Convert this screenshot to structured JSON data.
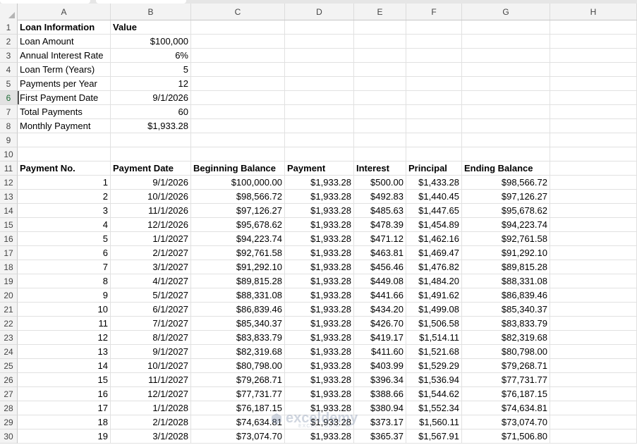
{
  "columns": [
    "A",
    "B",
    "C",
    "D",
    "E",
    "F",
    "G",
    "H"
  ],
  "watermark": {
    "title": "exceldemy",
    "subtitle": "EXCEL · DATA · BI"
  },
  "rows": [
    {
      "n": "1",
      "cells": [
        {
          "v": "Loan Information",
          "b": true
        },
        {
          "v": "Value",
          "b": true
        },
        {
          "v": ""
        },
        {
          "v": ""
        },
        {
          "v": ""
        },
        {
          "v": ""
        },
        {
          "v": ""
        },
        {
          "v": ""
        }
      ]
    },
    {
      "n": "2",
      "cells": [
        {
          "v": "Loan Amount"
        },
        {
          "v": "$100,000",
          "r": true
        },
        {
          "v": ""
        },
        {
          "v": ""
        },
        {
          "v": ""
        },
        {
          "v": ""
        },
        {
          "v": ""
        },
        {
          "v": ""
        }
      ]
    },
    {
      "n": "3",
      "cells": [
        {
          "v": "Annual Interest Rate"
        },
        {
          "v": "6%",
          "r": true
        },
        {
          "v": ""
        },
        {
          "v": ""
        },
        {
          "v": ""
        },
        {
          "v": ""
        },
        {
          "v": ""
        },
        {
          "v": ""
        }
      ]
    },
    {
      "n": "4",
      "cells": [
        {
          "v": "Loan Term (Years)"
        },
        {
          "v": "5",
          "r": true
        },
        {
          "v": ""
        },
        {
          "v": ""
        },
        {
          "v": ""
        },
        {
          "v": ""
        },
        {
          "v": ""
        },
        {
          "v": ""
        }
      ]
    },
    {
      "n": "5",
      "cells": [
        {
          "v": "Payments per Year"
        },
        {
          "v": "12",
          "r": true
        },
        {
          "v": ""
        },
        {
          "v": ""
        },
        {
          "v": ""
        },
        {
          "v": ""
        },
        {
          "v": ""
        },
        {
          "v": ""
        }
      ]
    },
    {
      "n": "6",
      "selected": true,
      "cells": [
        {
          "v": "First Payment Date",
          "active": true
        },
        {
          "v": "9/1/2026",
          "r": true
        },
        {
          "v": ""
        },
        {
          "v": ""
        },
        {
          "v": ""
        },
        {
          "v": ""
        },
        {
          "v": ""
        },
        {
          "v": ""
        }
      ]
    },
    {
      "n": "7",
      "cells": [
        {
          "v": "Total Payments"
        },
        {
          "v": "60",
          "r": true
        },
        {
          "v": ""
        },
        {
          "v": ""
        },
        {
          "v": ""
        },
        {
          "v": ""
        },
        {
          "v": ""
        },
        {
          "v": ""
        }
      ]
    },
    {
      "n": "8",
      "cells": [
        {
          "v": "Monthly Payment"
        },
        {
          "v": "$1,933.28",
          "r": true
        },
        {
          "v": ""
        },
        {
          "v": ""
        },
        {
          "v": ""
        },
        {
          "v": ""
        },
        {
          "v": ""
        },
        {
          "v": ""
        }
      ]
    },
    {
      "n": "9",
      "cells": [
        {
          "v": ""
        },
        {
          "v": ""
        },
        {
          "v": ""
        },
        {
          "v": ""
        },
        {
          "v": ""
        },
        {
          "v": ""
        },
        {
          "v": ""
        },
        {
          "v": ""
        }
      ]
    },
    {
      "n": "10",
      "cells": [
        {
          "v": ""
        },
        {
          "v": ""
        },
        {
          "v": ""
        },
        {
          "v": ""
        },
        {
          "v": ""
        },
        {
          "v": ""
        },
        {
          "v": ""
        },
        {
          "v": ""
        }
      ]
    },
    {
      "n": "11",
      "cells": [
        {
          "v": "Payment No.",
          "b": true
        },
        {
          "v": "Payment Date",
          "b": true
        },
        {
          "v": "Beginning Balance",
          "b": true
        },
        {
          "v": "Payment",
          "b": true
        },
        {
          "v": "Interest",
          "b": true
        },
        {
          "v": "Principal",
          "b": true
        },
        {
          "v": "Ending Balance",
          "b": true
        },
        {
          "v": ""
        }
      ]
    },
    {
      "n": "12",
      "cells": [
        {
          "v": "1",
          "r": true
        },
        {
          "v": "9/1/2026",
          "r": true
        },
        {
          "v": "$100,000.00",
          "r": true
        },
        {
          "v": "$1,933.28",
          "r": true
        },
        {
          "v": "$500.00",
          "r": true
        },
        {
          "v": "$1,433.28",
          "r": true
        },
        {
          "v": "$98,566.72",
          "r": true
        },
        {
          "v": ""
        }
      ]
    },
    {
      "n": "13",
      "cells": [
        {
          "v": "2",
          "r": true
        },
        {
          "v": "10/1/2026",
          "r": true
        },
        {
          "v": "$98,566.72",
          "r": true
        },
        {
          "v": "$1,933.28",
          "r": true
        },
        {
          "v": "$492.83",
          "r": true
        },
        {
          "v": "$1,440.45",
          "r": true
        },
        {
          "v": "$97,126.27",
          "r": true
        },
        {
          "v": ""
        }
      ]
    },
    {
      "n": "14",
      "cells": [
        {
          "v": "3",
          "r": true
        },
        {
          "v": "11/1/2026",
          "r": true
        },
        {
          "v": "$97,126.27",
          "r": true
        },
        {
          "v": "$1,933.28",
          "r": true
        },
        {
          "v": "$485.63",
          "r": true
        },
        {
          "v": "$1,447.65",
          "r": true
        },
        {
          "v": "$95,678.62",
          "r": true
        },
        {
          "v": ""
        }
      ]
    },
    {
      "n": "15",
      "cells": [
        {
          "v": "4",
          "r": true
        },
        {
          "v": "12/1/2026",
          "r": true
        },
        {
          "v": "$95,678.62",
          "r": true
        },
        {
          "v": "$1,933.28",
          "r": true
        },
        {
          "v": "$478.39",
          "r": true
        },
        {
          "v": "$1,454.89",
          "r": true
        },
        {
          "v": "$94,223.74",
          "r": true
        },
        {
          "v": ""
        }
      ]
    },
    {
      "n": "16",
      "cells": [
        {
          "v": "5",
          "r": true
        },
        {
          "v": "1/1/2027",
          "r": true
        },
        {
          "v": "$94,223.74",
          "r": true
        },
        {
          "v": "$1,933.28",
          "r": true
        },
        {
          "v": "$471.12",
          "r": true
        },
        {
          "v": "$1,462.16",
          "r": true
        },
        {
          "v": "$92,761.58",
          "r": true
        },
        {
          "v": ""
        }
      ]
    },
    {
      "n": "17",
      "cells": [
        {
          "v": "6",
          "r": true
        },
        {
          "v": "2/1/2027",
          "r": true
        },
        {
          "v": "$92,761.58",
          "r": true
        },
        {
          "v": "$1,933.28",
          "r": true
        },
        {
          "v": "$463.81",
          "r": true
        },
        {
          "v": "$1,469.47",
          "r": true
        },
        {
          "v": "$91,292.10",
          "r": true
        },
        {
          "v": ""
        }
      ]
    },
    {
      "n": "18",
      "cells": [
        {
          "v": "7",
          "r": true
        },
        {
          "v": "3/1/2027",
          "r": true
        },
        {
          "v": "$91,292.10",
          "r": true
        },
        {
          "v": "$1,933.28",
          "r": true
        },
        {
          "v": "$456.46",
          "r": true
        },
        {
          "v": "$1,476.82",
          "r": true
        },
        {
          "v": "$89,815.28",
          "r": true
        },
        {
          "v": ""
        }
      ]
    },
    {
      "n": "19",
      "cells": [
        {
          "v": "8",
          "r": true
        },
        {
          "v": "4/1/2027",
          "r": true
        },
        {
          "v": "$89,815.28",
          "r": true
        },
        {
          "v": "$1,933.28",
          "r": true
        },
        {
          "v": "$449.08",
          "r": true
        },
        {
          "v": "$1,484.20",
          "r": true
        },
        {
          "v": "$88,331.08",
          "r": true
        },
        {
          "v": ""
        }
      ]
    },
    {
      "n": "20",
      "cells": [
        {
          "v": "9",
          "r": true
        },
        {
          "v": "5/1/2027",
          "r": true
        },
        {
          "v": "$88,331.08",
          "r": true
        },
        {
          "v": "$1,933.28",
          "r": true
        },
        {
          "v": "$441.66",
          "r": true
        },
        {
          "v": "$1,491.62",
          "r": true
        },
        {
          "v": "$86,839.46",
          "r": true
        },
        {
          "v": ""
        }
      ]
    },
    {
      "n": "21",
      "cells": [
        {
          "v": "10",
          "r": true
        },
        {
          "v": "6/1/2027",
          "r": true
        },
        {
          "v": "$86,839.46",
          "r": true
        },
        {
          "v": "$1,933.28",
          "r": true
        },
        {
          "v": "$434.20",
          "r": true
        },
        {
          "v": "$1,499.08",
          "r": true
        },
        {
          "v": "$85,340.37",
          "r": true
        },
        {
          "v": ""
        }
      ]
    },
    {
      "n": "22",
      "cells": [
        {
          "v": "11",
          "r": true
        },
        {
          "v": "7/1/2027",
          "r": true
        },
        {
          "v": "$85,340.37",
          "r": true
        },
        {
          "v": "$1,933.28",
          "r": true
        },
        {
          "v": "$426.70",
          "r": true
        },
        {
          "v": "$1,506.58",
          "r": true
        },
        {
          "v": "$83,833.79",
          "r": true
        },
        {
          "v": ""
        }
      ]
    },
    {
      "n": "23",
      "cells": [
        {
          "v": "12",
          "r": true
        },
        {
          "v": "8/1/2027",
          "r": true
        },
        {
          "v": "$83,833.79",
          "r": true
        },
        {
          "v": "$1,933.28",
          "r": true
        },
        {
          "v": "$419.17",
          "r": true
        },
        {
          "v": "$1,514.11",
          "r": true
        },
        {
          "v": "$82,319.68",
          "r": true
        },
        {
          "v": ""
        }
      ]
    },
    {
      "n": "24",
      "cells": [
        {
          "v": "13",
          "r": true
        },
        {
          "v": "9/1/2027",
          "r": true
        },
        {
          "v": "$82,319.68",
          "r": true
        },
        {
          "v": "$1,933.28",
          "r": true
        },
        {
          "v": "$411.60",
          "r": true
        },
        {
          "v": "$1,521.68",
          "r": true
        },
        {
          "v": "$80,798.00",
          "r": true
        },
        {
          "v": ""
        }
      ]
    },
    {
      "n": "25",
      "cells": [
        {
          "v": "14",
          "r": true
        },
        {
          "v": "10/1/2027",
          "r": true
        },
        {
          "v": "$80,798.00",
          "r": true
        },
        {
          "v": "$1,933.28",
          "r": true
        },
        {
          "v": "$403.99",
          "r": true
        },
        {
          "v": "$1,529.29",
          "r": true
        },
        {
          "v": "$79,268.71",
          "r": true
        },
        {
          "v": ""
        }
      ]
    },
    {
      "n": "26",
      "cells": [
        {
          "v": "15",
          "r": true
        },
        {
          "v": "11/1/2027",
          "r": true
        },
        {
          "v": "$79,268.71",
          "r": true
        },
        {
          "v": "$1,933.28",
          "r": true
        },
        {
          "v": "$396.34",
          "r": true
        },
        {
          "v": "$1,536.94",
          "r": true
        },
        {
          "v": "$77,731.77",
          "r": true
        },
        {
          "v": ""
        }
      ]
    },
    {
      "n": "27",
      "cells": [
        {
          "v": "16",
          "r": true
        },
        {
          "v": "12/1/2027",
          "r": true
        },
        {
          "v": "$77,731.77",
          "r": true
        },
        {
          "v": "$1,933.28",
          "r": true
        },
        {
          "v": "$388.66",
          "r": true
        },
        {
          "v": "$1,544.62",
          "r": true
        },
        {
          "v": "$76,187.15",
          "r": true
        },
        {
          "v": ""
        }
      ]
    },
    {
      "n": "28",
      "cells": [
        {
          "v": "17",
          "r": true
        },
        {
          "v": "1/1/2028",
          "r": true
        },
        {
          "v": "$76,187.15",
          "r": true
        },
        {
          "v": "$1,933.28",
          "r": true
        },
        {
          "v": "$380.94",
          "r": true
        },
        {
          "v": "$1,552.34",
          "r": true
        },
        {
          "v": "$74,634.81",
          "r": true
        },
        {
          "v": ""
        }
      ]
    },
    {
      "n": "29",
      "cells": [
        {
          "v": "18",
          "r": true
        },
        {
          "v": "2/1/2028",
          "r": true
        },
        {
          "v": "$74,634.81",
          "r": true
        },
        {
          "v": "$1,933.28",
          "r": true
        },
        {
          "v": "$373.17",
          "r": true
        },
        {
          "v": "$1,560.11",
          "r": true
        },
        {
          "v": "$73,074.70",
          "r": true
        },
        {
          "v": ""
        }
      ]
    },
    {
      "n": "30",
      "cells": [
        {
          "v": "19",
          "r": true
        },
        {
          "v": "3/1/2028",
          "r": true
        },
        {
          "v": "$73,074.70",
          "r": true
        },
        {
          "v": "$1,933.28",
          "r": true
        },
        {
          "v": "$365.37",
          "r": true
        },
        {
          "v": "$1,567.91",
          "r": true
        },
        {
          "v": "$71,506.80",
          "r": true
        },
        {
          "v": ""
        }
      ]
    }
  ]
}
